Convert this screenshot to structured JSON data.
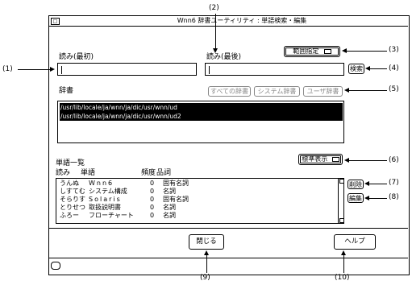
{
  "window": {
    "title": "Wnn6 辞書ユーティリティ : 単語検索・編集",
    "menu_glyph": "□"
  },
  "search": {
    "read_first_label": "読み(最初)",
    "read_last_label": "読み(最後)",
    "read_first_value": "",
    "read_last_value": "",
    "range_button": "範囲指定",
    "search_button": "検索"
  },
  "dictionary": {
    "label": "辞書",
    "all_button": "すべての辞書",
    "system_button": "システム辞書",
    "user_button": "ユーザ辞書",
    "paths": [
      "/usr/lib/locale/ja/wnn/ja/dic/usr/wnn/ud",
      "/usr/lib/locale/ja/wnn/ja/dic/usr/wnn/ud2"
    ]
  },
  "wordlist": {
    "label": "単語一覧",
    "display_button": "標準表示",
    "col_reading": "読み",
    "col_word": "単語",
    "col_freq": "頻度",
    "col_pos": "品詞",
    "rows": [
      {
        "reading": "うんぬ",
        "word": "Wnn6",
        "freq": "0",
        "pos": "固有名詞"
      },
      {
        "reading": "しすてむ",
        "word": "システム構成",
        "freq": "0",
        "pos": "名詞"
      },
      {
        "reading": "そらりす",
        "word": "Solaris",
        "freq": "0",
        "pos": "固有名詞"
      },
      {
        "reading": "とりせつ",
        "word": "取扱説明書",
        "freq": "0",
        "pos": "名詞"
      },
      {
        "reading": "ふろー",
        "word": "フローチャート",
        "freq": "0",
        "pos": "名詞"
      }
    ],
    "delete_button": "削除",
    "edit_button": "編集"
  },
  "footer": {
    "close_button": "閉じる",
    "help_button": "ヘルプ"
  },
  "callouts": {
    "c1": "(1)",
    "c2": "(2)",
    "c3": "(3)",
    "c4": "(4)",
    "c5": "(5)",
    "c6": "(6)",
    "c7": "(7)",
    "c8": "(8)",
    "c9": "(9)",
    "c10": "(10)"
  }
}
